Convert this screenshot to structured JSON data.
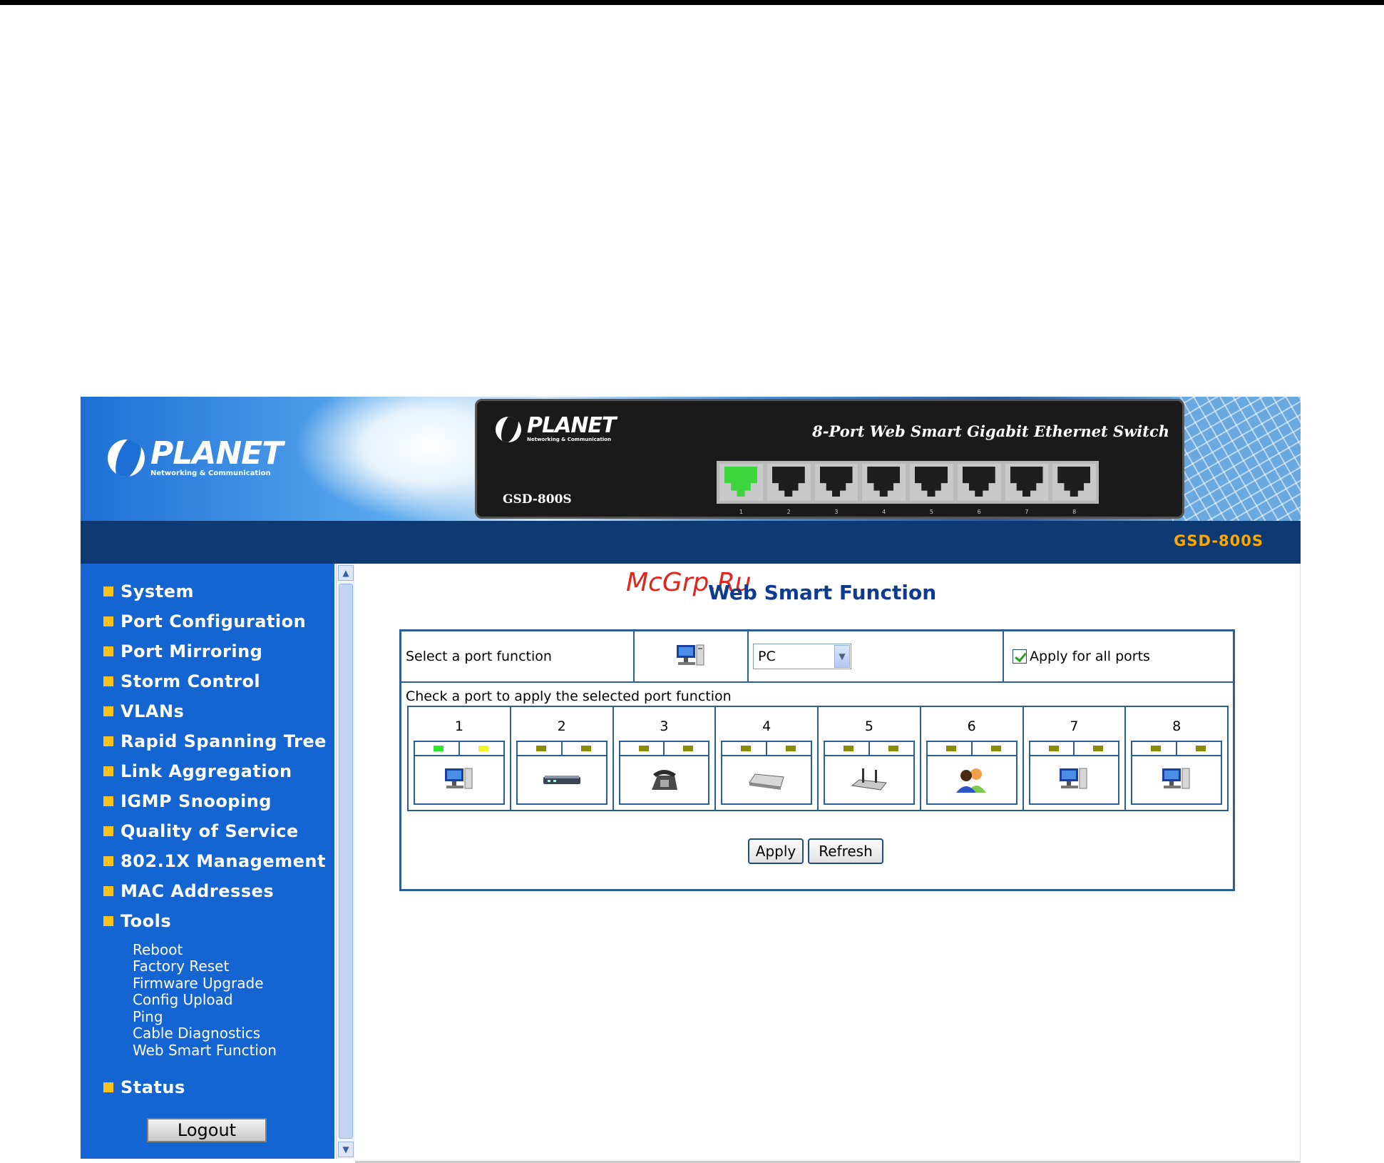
{
  "banner": {
    "logo_text": "PLANET",
    "logo_tagline": "Networking & Communication",
    "device_title": "8-Port Web Smart Gigabit Ethernet Switch",
    "device_model": "GSD-800S",
    "device_ports": [
      "1",
      "2",
      "3",
      "4",
      "5",
      "6",
      "7",
      "8"
    ],
    "strip_model": "GSD-800S"
  },
  "sidebar": {
    "menu": [
      {
        "label": "System"
      },
      {
        "label": "Port Configuration"
      },
      {
        "label": "Port Mirroring"
      },
      {
        "label": "Storm Control"
      },
      {
        "label": "VLANs"
      },
      {
        "label": "Rapid Spanning Tree"
      },
      {
        "label": "Link Aggregation"
      },
      {
        "label": "IGMP Snooping"
      },
      {
        "label": "Quality of Service"
      },
      {
        "label": "802.1X Management"
      },
      {
        "label": "MAC Addresses"
      },
      {
        "label": "Tools"
      }
    ],
    "tools_sub": [
      "Reboot",
      "Factory Reset",
      "Firmware Upgrade",
      "Config Upload",
      "Ping",
      "Cable Diagnostics",
      "Web Smart Function"
    ],
    "status_label": "Status",
    "logout_label": "Logout"
  },
  "main": {
    "watermark": "McGrp.Ru",
    "title": "Web Smart Function",
    "select_label": "Select a port function",
    "function_icon": "pc-icon",
    "function_value": "PC",
    "apply_all_label": "Apply for all ports",
    "apply_all_checked": true,
    "check_label": "Check a port to apply the selected port function",
    "ports": [
      {
        "num": "1",
        "icon": "pc-icon",
        "led1": "#2ee82e",
        "led2": "#f2f22a"
      },
      {
        "num": "2",
        "icon": "switch-icon"
      },
      {
        "num": "3",
        "icon": "phone-icon"
      },
      {
        "num": "4",
        "icon": "access-point-icon"
      },
      {
        "num": "5",
        "icon": "router-icon"
      },
      {
        "num": "6",
        "icon": "users-icon"
      },
      {
        "num": "7",
        "icon": "pc-icon"
      },
      {
        "num": "8",
        "icon": "pc-icon"
      }
    ],
    "apply_label": "Apply",
    "refresh_label": "Refresh"
  },
  "colors": {
    "sidebar_bg": "#1464d2",
    "nav_strip": "#0e3a74",
    "model_accent": "#ffa800",
    "panel_border": "#2c5f97",
    "title": "#0d3b8f"
  }
}
